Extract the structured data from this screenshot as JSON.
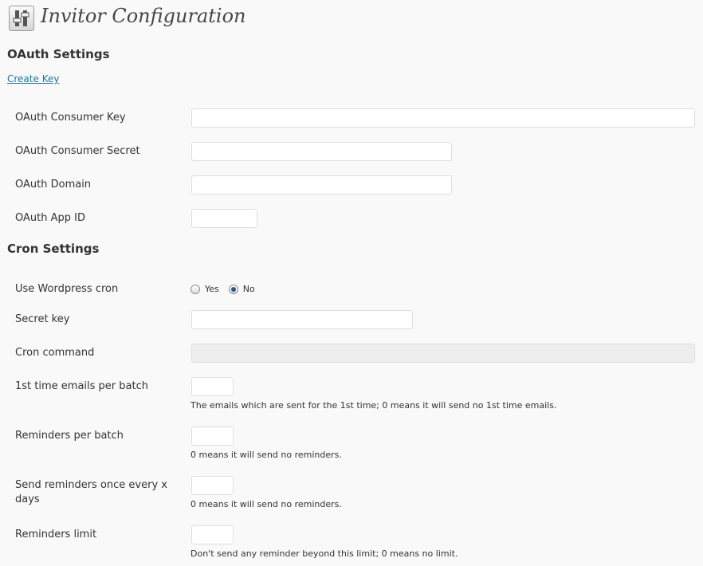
{
  "page": {
    "title": "Invitor Configuration",
    "icon": "settings-sliders-icon"
  },
  "oauth": {
    "heading": "OAuth Settings",
    "create_key_link": "Create Key",
    "consumer_key_label": "OAuth Consumer Key",
    "consumer_key_value": "",
    "consumer_secret_label": "OAuth Consumer Secret",
    "consumer_secret_value": "",
    "domain_label": "OAuth Domain",
    "domain_value": "",
    "app_id_label": "OAuth App ID",
    "app_id_value": ""
  },
  "cron": {
    "heading": "Cron Settings",
    "use_wp_cron_label": "Use Wordpress cron",
    "use_wp_cron_options": [
      "Yes",
      "No"
    ],
    "use_wp_cron_selected": "No",
    "secret_key_label": "Secret key",
    "secret_key_value": "",
    "cron_command_label": "Cron command",
    "cron_command_value": "",
    "first_time_label": "1st time emails per batch",
    "first_time_value": "",
    "first_time_desc": "The emails which are sent for the 1st time; 0 means it will send no 1st time emails.",
    "reminders_batch_label": "Reminders per batch",
    "reminders_batch_value": "",
    "reminders_batch_desc": "0 means it will send no reminders.",
    "reminders_interval_label_line1": "Send reminders once every x",
    "reminders_interval_label_line2": "days",
    "reminders_interval_value": "",
    "reminders_interval_desc": "0 means it will send no reminders.",
    "reminders_limit_label": "Reminders limit",
    "reminders_limit_value": "",
    "reminders_limit_desc": "Don't send any reminder beyond this limit; 0 means no limit."
  },
  "colors": {
    "link": "#21759b",
    "radio_checked": "#25598a",
    "background": "#f9f9f9"
  }
}
